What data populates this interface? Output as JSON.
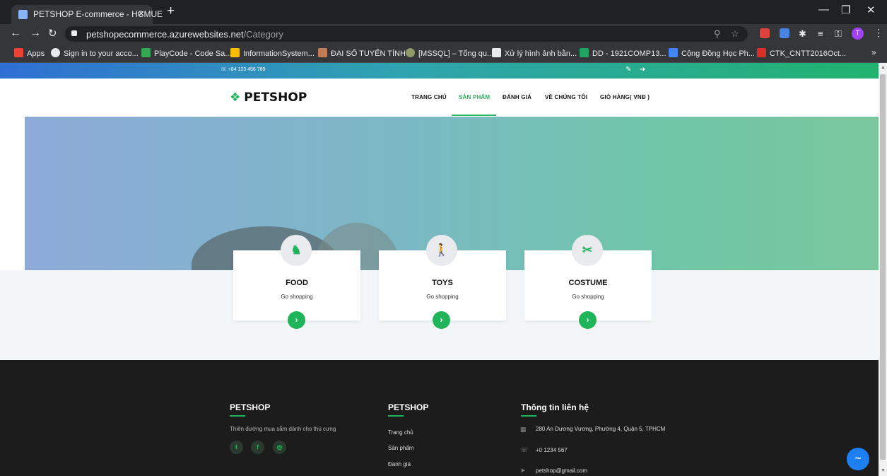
{
  "browser": {
    "tab_title": "PETSHOP E-commerce - HCMUE",
    "tab_close": "×",
    "new_tab": "+",
    "minimize": "—",
    "maximize": "❐",
    "close": "✕",
    "url_host": "petshopecommerce.azurewebsites.net",
    "url_path": "/Category",
    "avatar_letter": "T",
    "bookmarks": [
      "Apps",
      "Sign in to your acco...",
      "PlayCode - Code Sa...",
      "InformationSystem...",
      "ĐẠI SỐ TUYẾN TÍNH",
      "[MSSQL] – Tổng qu...",
      "Xử lý hình ảnh bằn...",
      "DD - 1921COMP13...",
      "Cộng Đồng Học Ph...",
      "CTK_CNTT2016Oct..."
    ],
    "bookmarks_more": "»"
  },
  "topbar": {
    "phone": "+84 123 456 789"
  },
  "header": {
    "logo": "PETSHOP",
    "nav": [
      "TRANG CHỦ",
      "SẢN PHẨM",
      "ĐÁNH GIÁ",
      "VỀ CHÚNG TÔI",
      "GIỎ HÀNG( VNĐ )"
    ],
    "active_index": 1
  },
  "categories": [
    {
      "title": "FOOD",
      "subtitle": "Go shopping",
      "icon": "dog-icon"
    },
    {
      "title": "TOYS",
      "subtitle": "Go shopping",
      "icon": "dog-walker-icon"
    },
    {
      "title": "COSTUME",
      "subtitle": "Go shopping",
      "icon": "grooming-icon"
    }
  ],
  "footer": {
    "col1": {
      "title": "PETSHOP",
      "tagline": "Thiên đường mua sắm dành cho thú cưng",
      "social": [
        "twitter",
        "facebook",
        "instagram"
      ]
    },
    "col2": {
      "title": "PETSHOP",
      "links": [
        "Trang chủ",
        "Sản phẩm",
        "Đánh giá"
      ]
    },
    "col3": {
      "title": "Thông tin liên hệ",
      "address": "280 An Dương Vương, Phường 4, Quận 5, TPHCM",
      "phone": "+0 1234 567",
      "email": "petshop@gmail.com"
    }
  },
  "colors": {
    "accent": "#1fb35a",
    "footer_bg": "#1c1c1c",
    "messenger": "#1c7ff2"
  }
}
